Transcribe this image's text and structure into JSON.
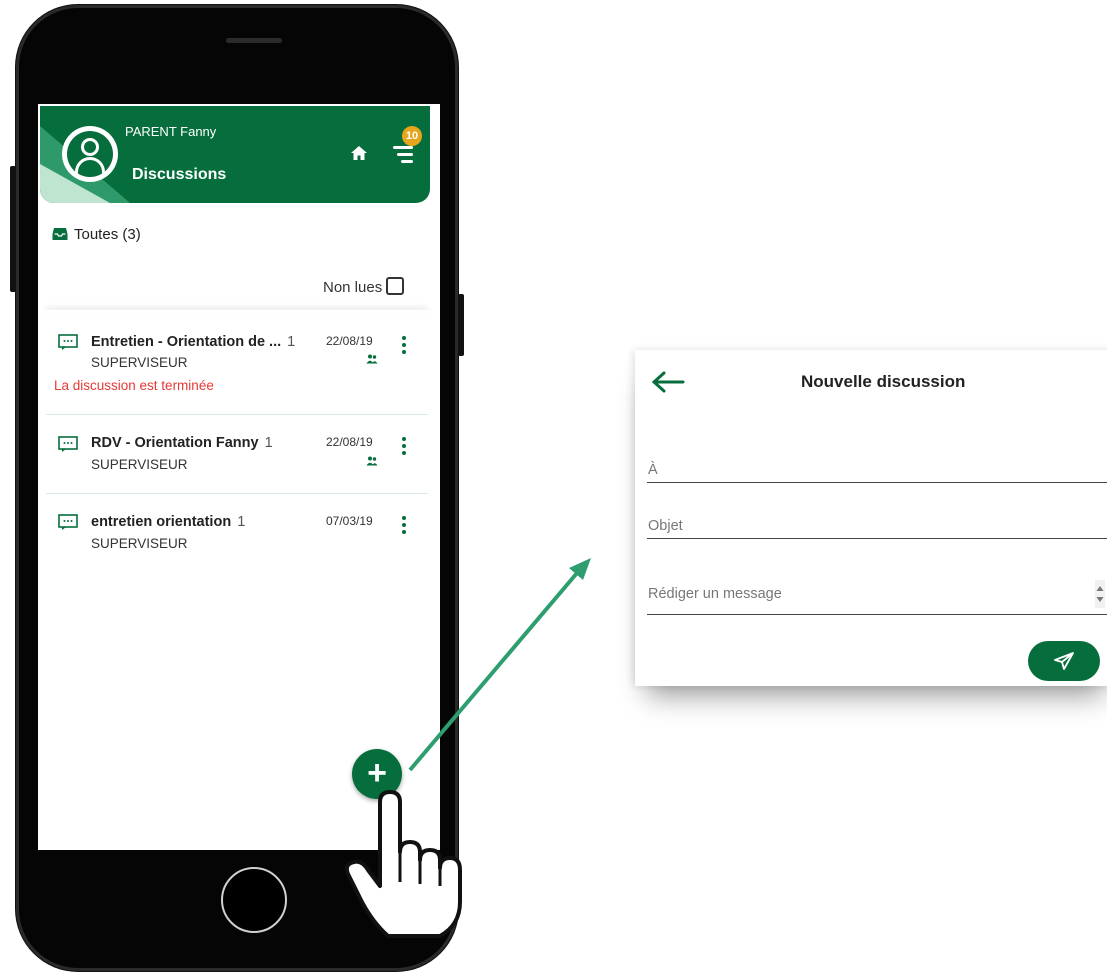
{
  "header": {
    "user_name": "PARENT Fanny",
    "title": "Discussions",
    "badge_count": "10"
  },
  "filter": {
    "all_label": "Toutes (3)",
    "unread_label": "Non lues"
  },
  "discussions": [
    {
      "title": "Entretien - Orientation de ...",
      "count": "1",
      "author": "SUPERVISEUR",
      "date": "22/08/19",
      "status": "La discussion est terminée",
      "group": true
    },
    {
      "title": "RDV - Orientation Fanny",
      "count": "1",
      "author": "SUPERVISEUR",
      "date": "22/08/19",
      "status": "",
      "group": true
    },
    {
      "title": "entretien orientation",
      "count": "1",
      "author": "SUPERVISEUR",
      "date": "07/03/19",
      "status": "",
      "group": false
    }
  ],
  "fab": {
    "label": "+"
  },
  "modal": {
    "title": "Nouvelle discussion",
    "to_label": "À",
    "subject_placeholder": "Objet",
    "message_placeholder": "Rédiger un message"
  },
  "colors": {
    "brand_green": "#066e3c",
    "light_green": "#2e9a6c",
    "badge": "#e5a51c",
    "status_red": "#e53935",
    "arrow": "#2e9e6e"
  },
  "icons": [
    "home-icon",
    "menu-icon",
    "inbox-icon",
    "message-icon",
    "group-icon",
    "kebab-icon",
    "plus-icon",
    "back-arrow-icon",
    "send-icon",
    "hand-pointer-icon"
  ]
}
